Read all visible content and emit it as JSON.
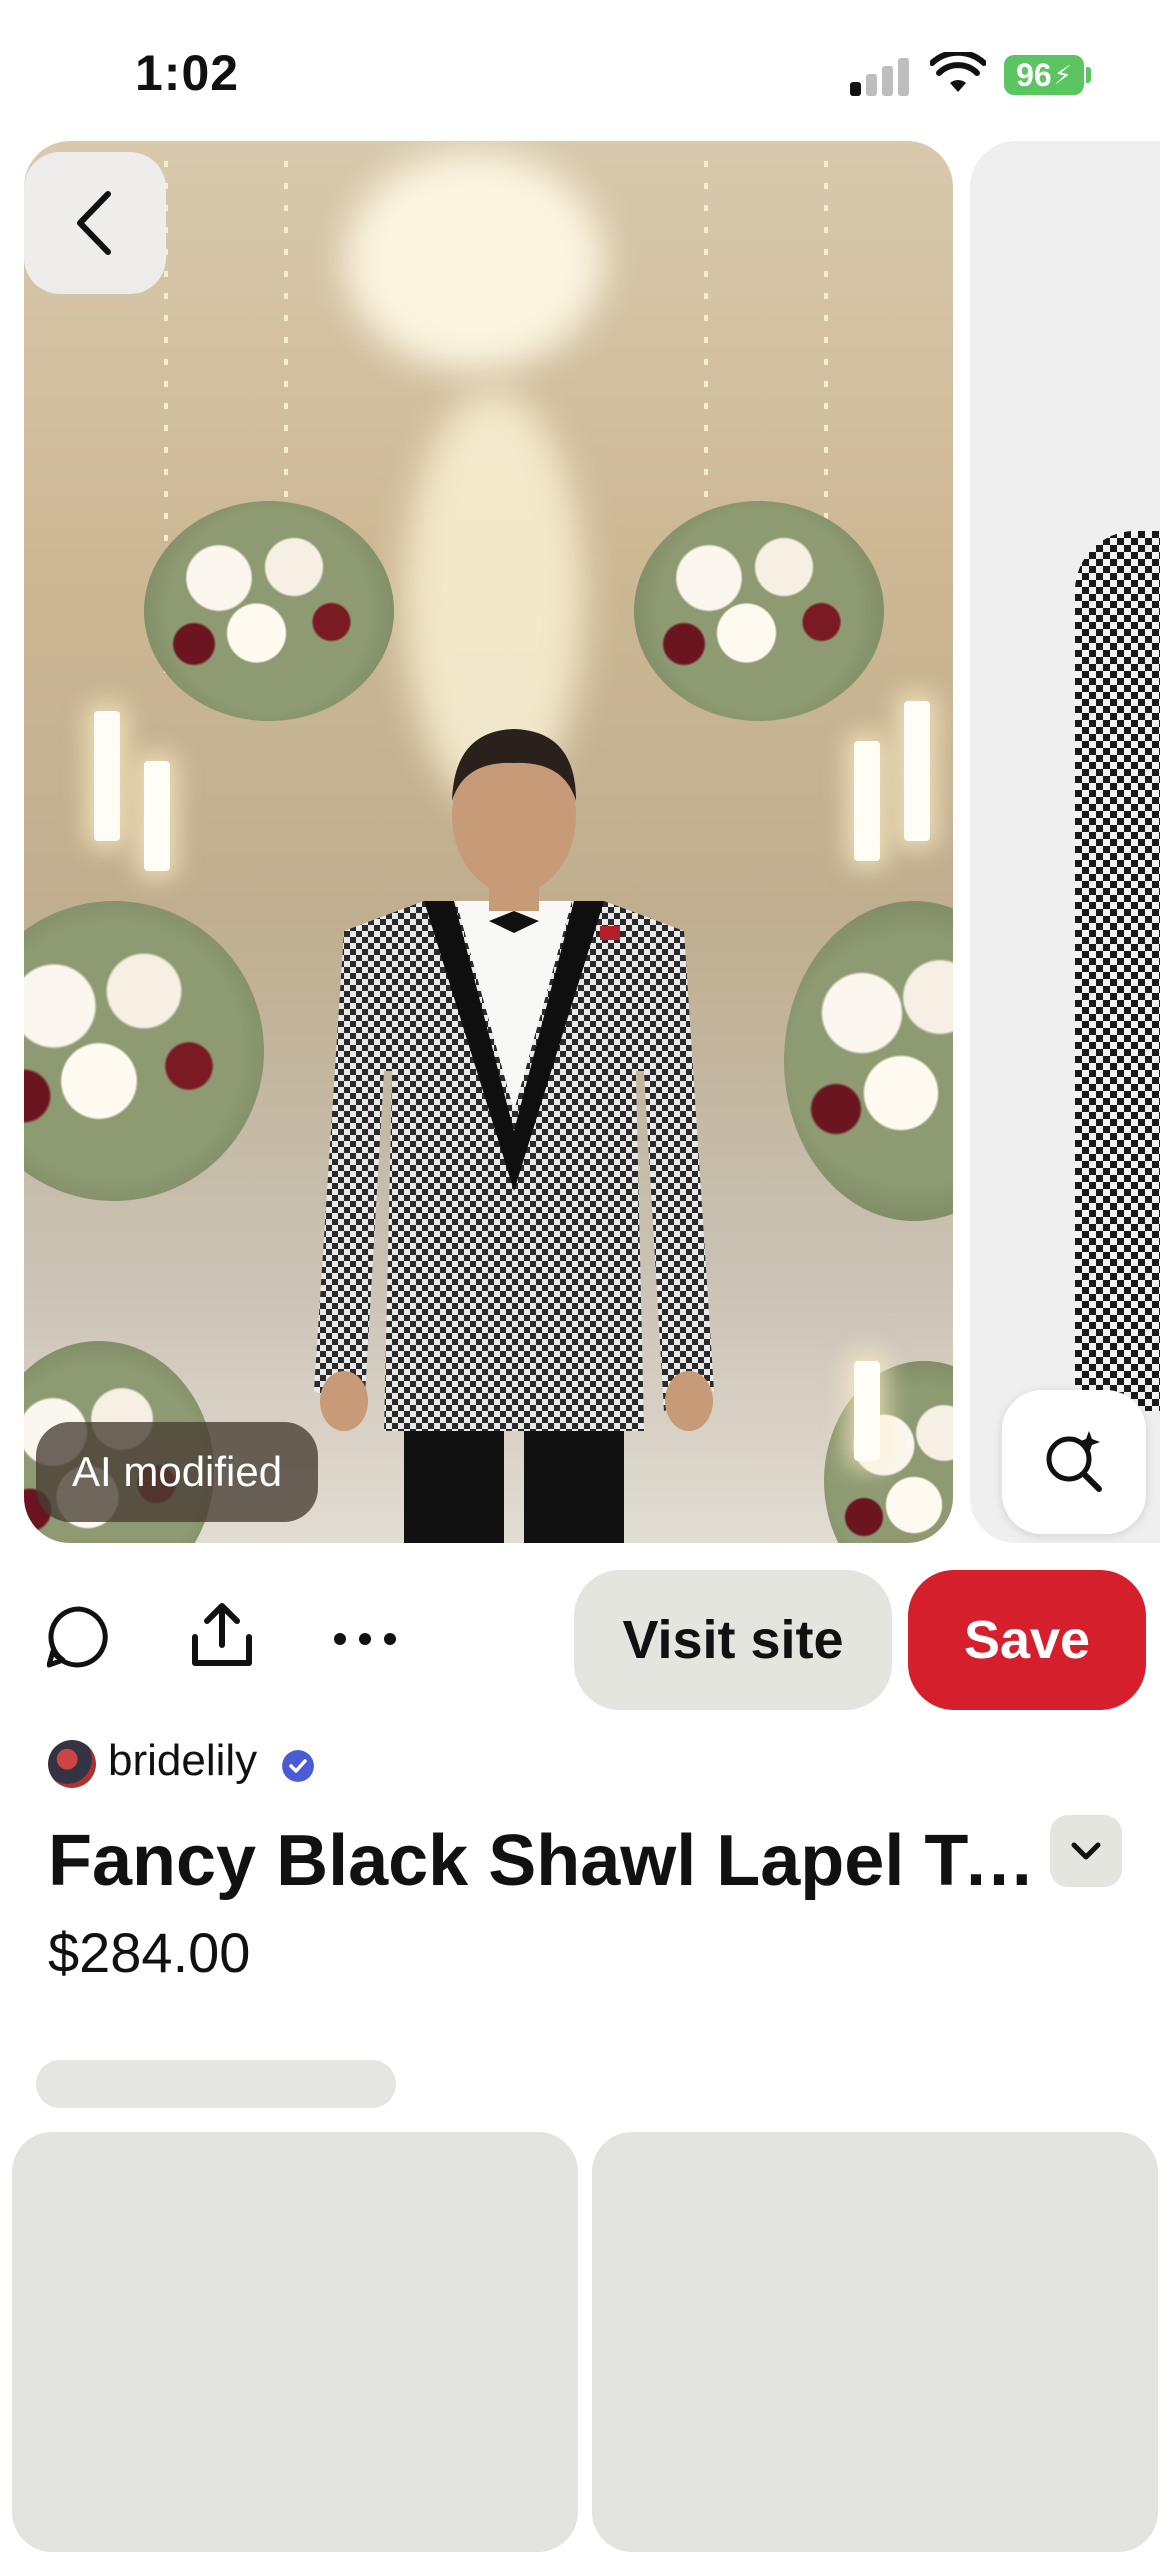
{
  "status_bar": {
    "time": "1:02",
    "battery": "96"
  },
  "hero": {
    "badge": "AI modified"
  },
  "actions": {
    "visit_label": "Visit site",
    "save_label": "Save"
  },
  "pin": {
    "creator": "bridelily",
    "title": "Fancy Black Shawl Lapel Tux...",
    "price": "$284.00"
  },
  "colors": {
    "save": "#d51f2c",
    "verified": "#4a5bd6",
    "battery": "#5bc561"
  },
  "icons": [
    "back-arrow-icon",
    "visual-search-icon",
    "comment-icon",
    "share-icon",
    "more-icon",
    "verified-icon",
    "chevron-down-icon"
  ]
}
